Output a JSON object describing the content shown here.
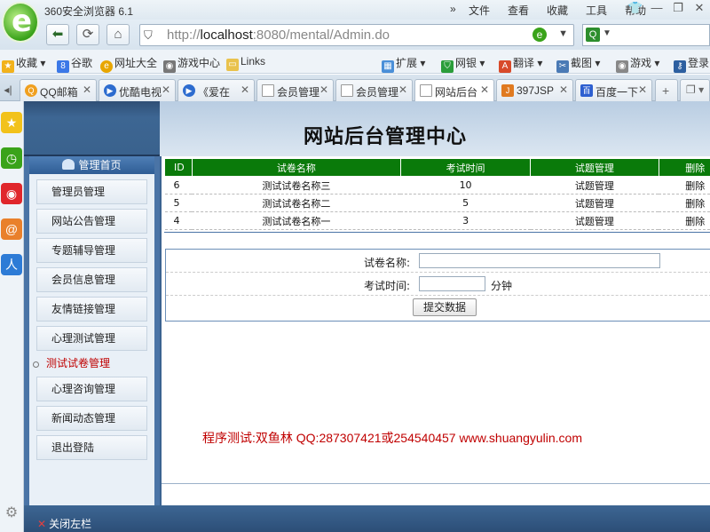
{
  "browser": {
    "title": "360安全浏览器 6.1",
    "menu": [
      "文件",
      "查看",
      "收藏",
      "工具",
      "帮助"
    ],
    "menu_more": "»",
    "url_host": "localhost",
    "url_rest": ":8080/mental/Admin.do",
    "url_prefix": "http://",
    "bookmarks": [
      "收藏",
      "谷歌",
      "网址大全",
      "游戏中心",
      "Links",
      "扩展",
      "网银",
      "翻译",
      "截图",
      "游戏",
      "登录"
    ],
    "tabs": [
      "QQ邮箱",
      "优酷电视",
      "《爱在",
      "会员管理",
      "会员管理",
      "网站后台",
      "397JSP",
      "百度一下"
    ],
    "active_tab_index": 5
  },
  "page": {
    "header_title": "网站后台管理中心",
    "nav_head": "管理首页",
    "nav_items": [
      "管理员管理",
      "网站公告管理",
      "专题辅导管理",
      "会员信息管理",
      "友情链接管理",
      "心理测试管理",
      "测试试卷管理",
      "心理咨询管理",
      "新闻动态管理",
      "退出登陆"
    ],
    "current_nav_index": 6,
    "table": {
      "headers": [
        "ID",
        "试卷名称",
        "考试时间",
        "试题管理",
        "删除"
      ],
      "rows": [
        {
          "id": "6",
          "name": "测试试卷名称三",
          "time": "10",
          "manage": "试题管理",
          "delete": "删除"
        },
        {
          "id": "5",
          "name": "测试试卷名称二",
          "time": "5",
          "manage": "试题管理",
          "delete": "删除"
        },
        {
          "id": "4",
          "name": "测试试卷名称一",
          "time": "3",
          "manage": "试题管理",
          "delete": "删除"
        }
      ]
    },
    "form": {
      "name_label": "试卷名称:",
      "name_value": "",
      "time_label": "考试时间:",
      "time_value": "",
      "time_unit": "分钟",
      "submit_label": "提交数据"
    },
    "credit": "程序测试:双鱼林 QQ:287307421或254540457 www.shuangyulin.com",
    "close_left": "关闭左栏"
  },
  "colors": {
    "table_header": "#0a7a0a",
    "current_nav": "#c00000",
    "header_blue": "#3a628d"
  }
}
